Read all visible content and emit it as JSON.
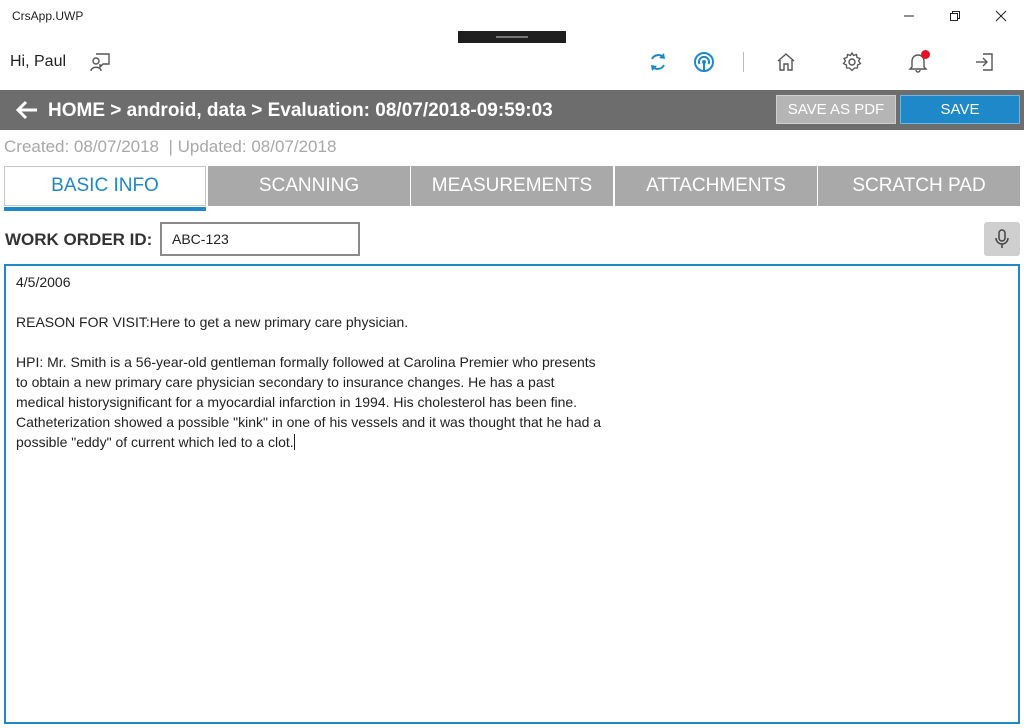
{
  "window": {
    "title": "CrsApp.UWP"
  },
  "header": {
    "greeting": "Hi, Paul"
  },
  "breadcrumb": {
    "text": "HOME > android, data > Evaluation: 08/07/2018-09:59:03"
  },
  "actions": {
    "save_pdf_label": "SAVE AS PDF",
    "save_label": "SAVE"
  },
  "dates": {
    "text": "Created: 08/07/2018  | Updated: 08/07/2018"
  },
  "tabs": [
    {
      "label": "BASIC INFO",
      "active": true
    },
    {
      "label": "SCANNING",
      "active": false
    },
    {
      "label": "MEASUREMENTS",
      "active": false
    },
    {
      "label": "ATTACHMENTS",
      "active": false
    },
    {
      "label": "SCRATCH PAD",
      "active": false
    }
  ],
  "work_order": {
    "label": "WORK ORDER ID:",
    "value": "ABC-123"
  },
  "notes": {
    "date": "4/5/2006",
    "reason": "REASON FOR VISIT:Here to get a new primary care physician.",
    "hpi": "HPI: Mr. Smith is a 56-year-old gentleman formally followed at Carolina Premier who presents to obtain a new primary care physician secondary to insurance changes. He has a past medical historysignificant for a myocardial infarction in 1994. His cholesterol has been fine. Catheterization showed a possible \"kink\" in one of his vessels and it was thought that he had a possible \"eddy\" of current which led to a clot."
  },
  "icons": {
    "feedback": "feedback-icon",
    "sync": "sync-icon",
    "broadcast": "broadcast-icon",
    "home": "home-icon",
    "settings": "gear-icon",
    "notifications": "bell-icon",
    "logout": "logout-icon",
    "microphone": "microphone-icon"
  },
  "colors": {
    "accent": "#1e88c9",
    "breadcrumb_bg": "#6d6d6d",
    "tab_inactive": "#a9a9a9",
    "notification": "#e81123"
  }
}
